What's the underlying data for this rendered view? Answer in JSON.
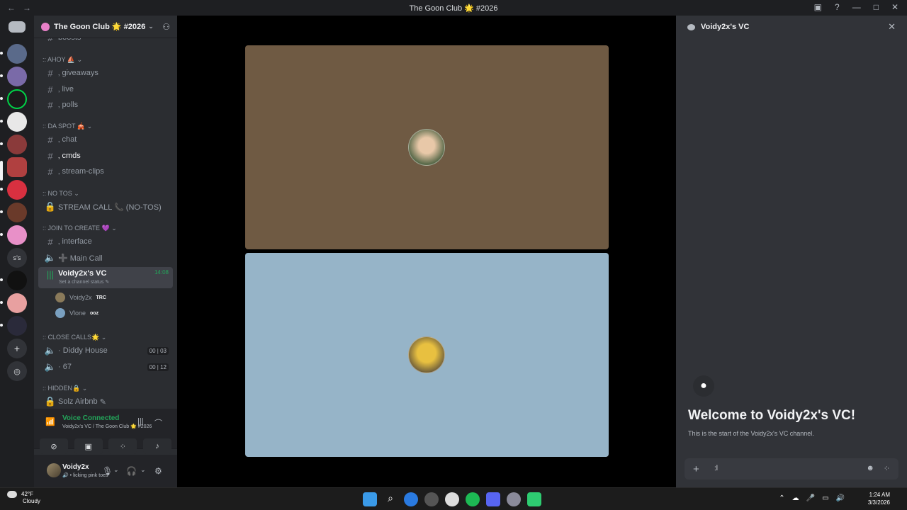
{
  "window": {
    "title": "The Goon Club 🌟 #2026"
  },
  "guild": {
    "name": "The Goon Club 🌟 #2026"
  },
  "channels": {
    "partial_top": "boosts",
    "categories": {
      "ahoy": "AHOY ⛵",
      "da_spot": "DA SPOT 🎪",
      "no_tos": "NO TOS",
      "join_to_create": "JOIN TO CREATE 💜",
      "close_calls": "CLOSE CALLS🌟",
      "hidden": "HIDDEN🔒"
    },
    "items": {
      "giveaways": "giveaways",
      "live": "live",
      "polls": "polls",
      "chat": "chat",
      "cmds": "cmds",
      "stream_clips": "stream-clips",
      "stream_call": "STREAM CALL 📞 (NO-TOS)",
      "interface": "interface",
      "main_call": "➕ Main Call",
      "voidy_vc": "Voidy2x's VC",
      "voidy_vc_timer": "14:08",
      "voidy_vc_status": "Set a channel status",
      "diddy_house": "Diddy House",
      "diddy_badge_a": "00",
      "diddy_badge_b": "03",
      "sixty_seven": "67",
      "sixty_seven_badge_a": "00",
      "sixty_seven_badge_b": "12",
      "solz": "Solz Airbnb"
    },
    "voice_users": [
      {
        "name": "Voidy2x",
        "tag": "TRC"
      },
      {
        "name": "Vlone",
        "tag": "ooz"
      }
    ]
  },
  "voice_panel": {
    "status": "Voice Connected",
    "location": "Voidy2x's VC / The Goon Club 🌟 #2026"
  },
  "user": {
    "name": "Voidy2x",
    "status": "licking pink toes"
  },
  "chat": {
    "title": "Voidy2x's VC",
    "welcome_title": "Welcome to Voidy2x's VC!",
    "welcome_sub": "This is the start of the Voidy2x's VC channel.",
    "composer_value": ":l"
  },
  "taskbar": {
    "temp": "42°F",
    "weather": "Cloudy",
    "time": "1:24 AM",
    "date": "3/3/2026"
  },
  "colors": {
    "accent_green": "#23a55a",
    "tile_top": "#6f5a43",
    "tile_bottom": "#96b4c8"
  }
}
